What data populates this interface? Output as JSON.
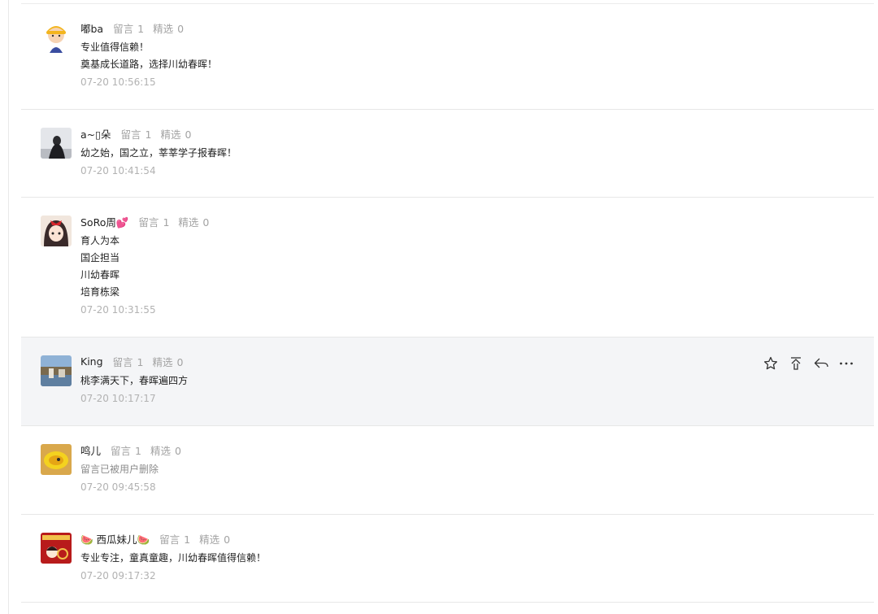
{
  "labels": {
    "reply_count": "留言",
    "featured_count": "精选"
  },
  "comments": [
    {
      "nickname": "嘟ba",
      "replies": "1",
      "featured": "0",
      "lines": [
        "专业值得信赖！",
        "奠基成长道路，选择川幼春晖！"
      ],
      "time": "07-20 10:56:15"
    },
    {
      "nickname": "a~\u0000朵",
      "nickname_display": "a~▯朵",
      "replies": "1",
      "featured": "0",
      "lines": [
        "幼之始，国之立，莘莘学子报春晖！"
      ],
      "time": "07-20 10:41:54"
    },
    {
      "nickname": "SoRo周💕",
      "replies": "1",
      "featured": "0",
      "lines": [
        "育人为本",
        "国企担当",
        "川幼春晖",
        "培育栋梁"
      ],
      "time": "07-20 10:31:55"
    },
    {
      "nickname": "King",
      "replies": "1",
      "featured": "0",
      "lines": [
        "桃李满天下，春晖遍四方"
      ],
      "time": "07-20 10:17:17"
    },
    {
      "nickname": "鸣儿",
      "replies": "1",
      "featured": "0",
      "lines": [
        "留言已被用户删除"
      ],
      "time": "07-20 09:45:58"
    },
    {
      "nickname": "🍉 西瓜妹儿🍉",
      "replies": "1",
      "featured": "0",
      "lines": [
        "专业专注，童真童趣，川幼春晖值得信赖！"
      ],
      "time": "07-20 09:17:32"
    }
  ],
  "hover_actions": [
    "star-icon",
    "pin-to-top-icon",
    "reply-icon",
    "more-icon"
  ],
  "colors": {
    "nickname": "#222222",
    "meta": "#a3a3a3",
    "time": "#b2b2b2",
    "hover_bg": "#f4f5f7",
    "divider": "#e7e7e7"
  }
}
